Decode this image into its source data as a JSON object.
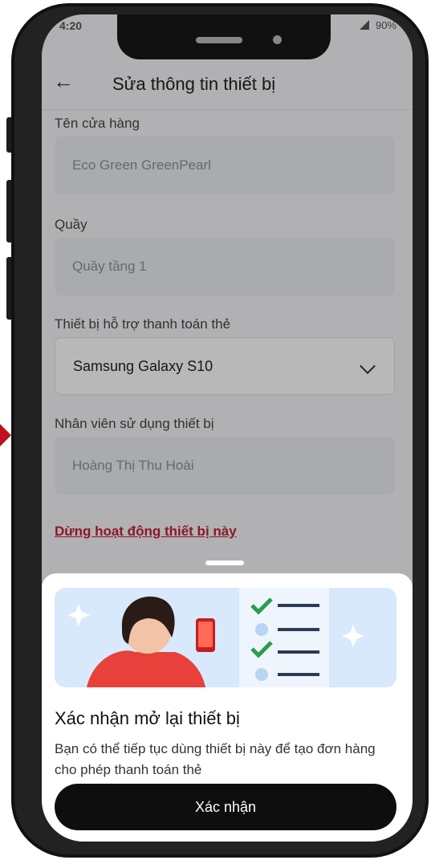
{
  "status": {
    "time": "4:20",
    "battery": "90%"
  },
  "header": {
    "title": "Sửa thông tin thiết bị"
  },
  "form": {
    "store_label": "Tên cửa hàng",
    "store_value": "Eco Green GreenPearl",
    "counter_label": "Quầy",
    "counter_value": "Quầy tầng 1",
    "device_label": "Thiết bị hỗ trợ thanh toán thẻ",
    "device_value": "Samsung Galaxy S10",
    "staff_label": "Nhân viên sử dụng thiết bị",
    "staff_value": "Hoàng Thị Thu Hoài"
  },
  "stop_link": "Dừng hoạt động thiết bị này",
  "sheet": {
    "title": "Xác nhận mở lại thiết bị",
    "description": "Bạn có thể tiếp tục dùng thiết bị này để tạo đơn hàng cho phép thanh toán thẻ",
    "confirm_label": "Xác nhận"
  },
  "colors": {
    "accent_red": "#c41f3b",
    "primary_dark": "#0e0e0e",
    "arrow_red": "#c0121c"
  }
}
